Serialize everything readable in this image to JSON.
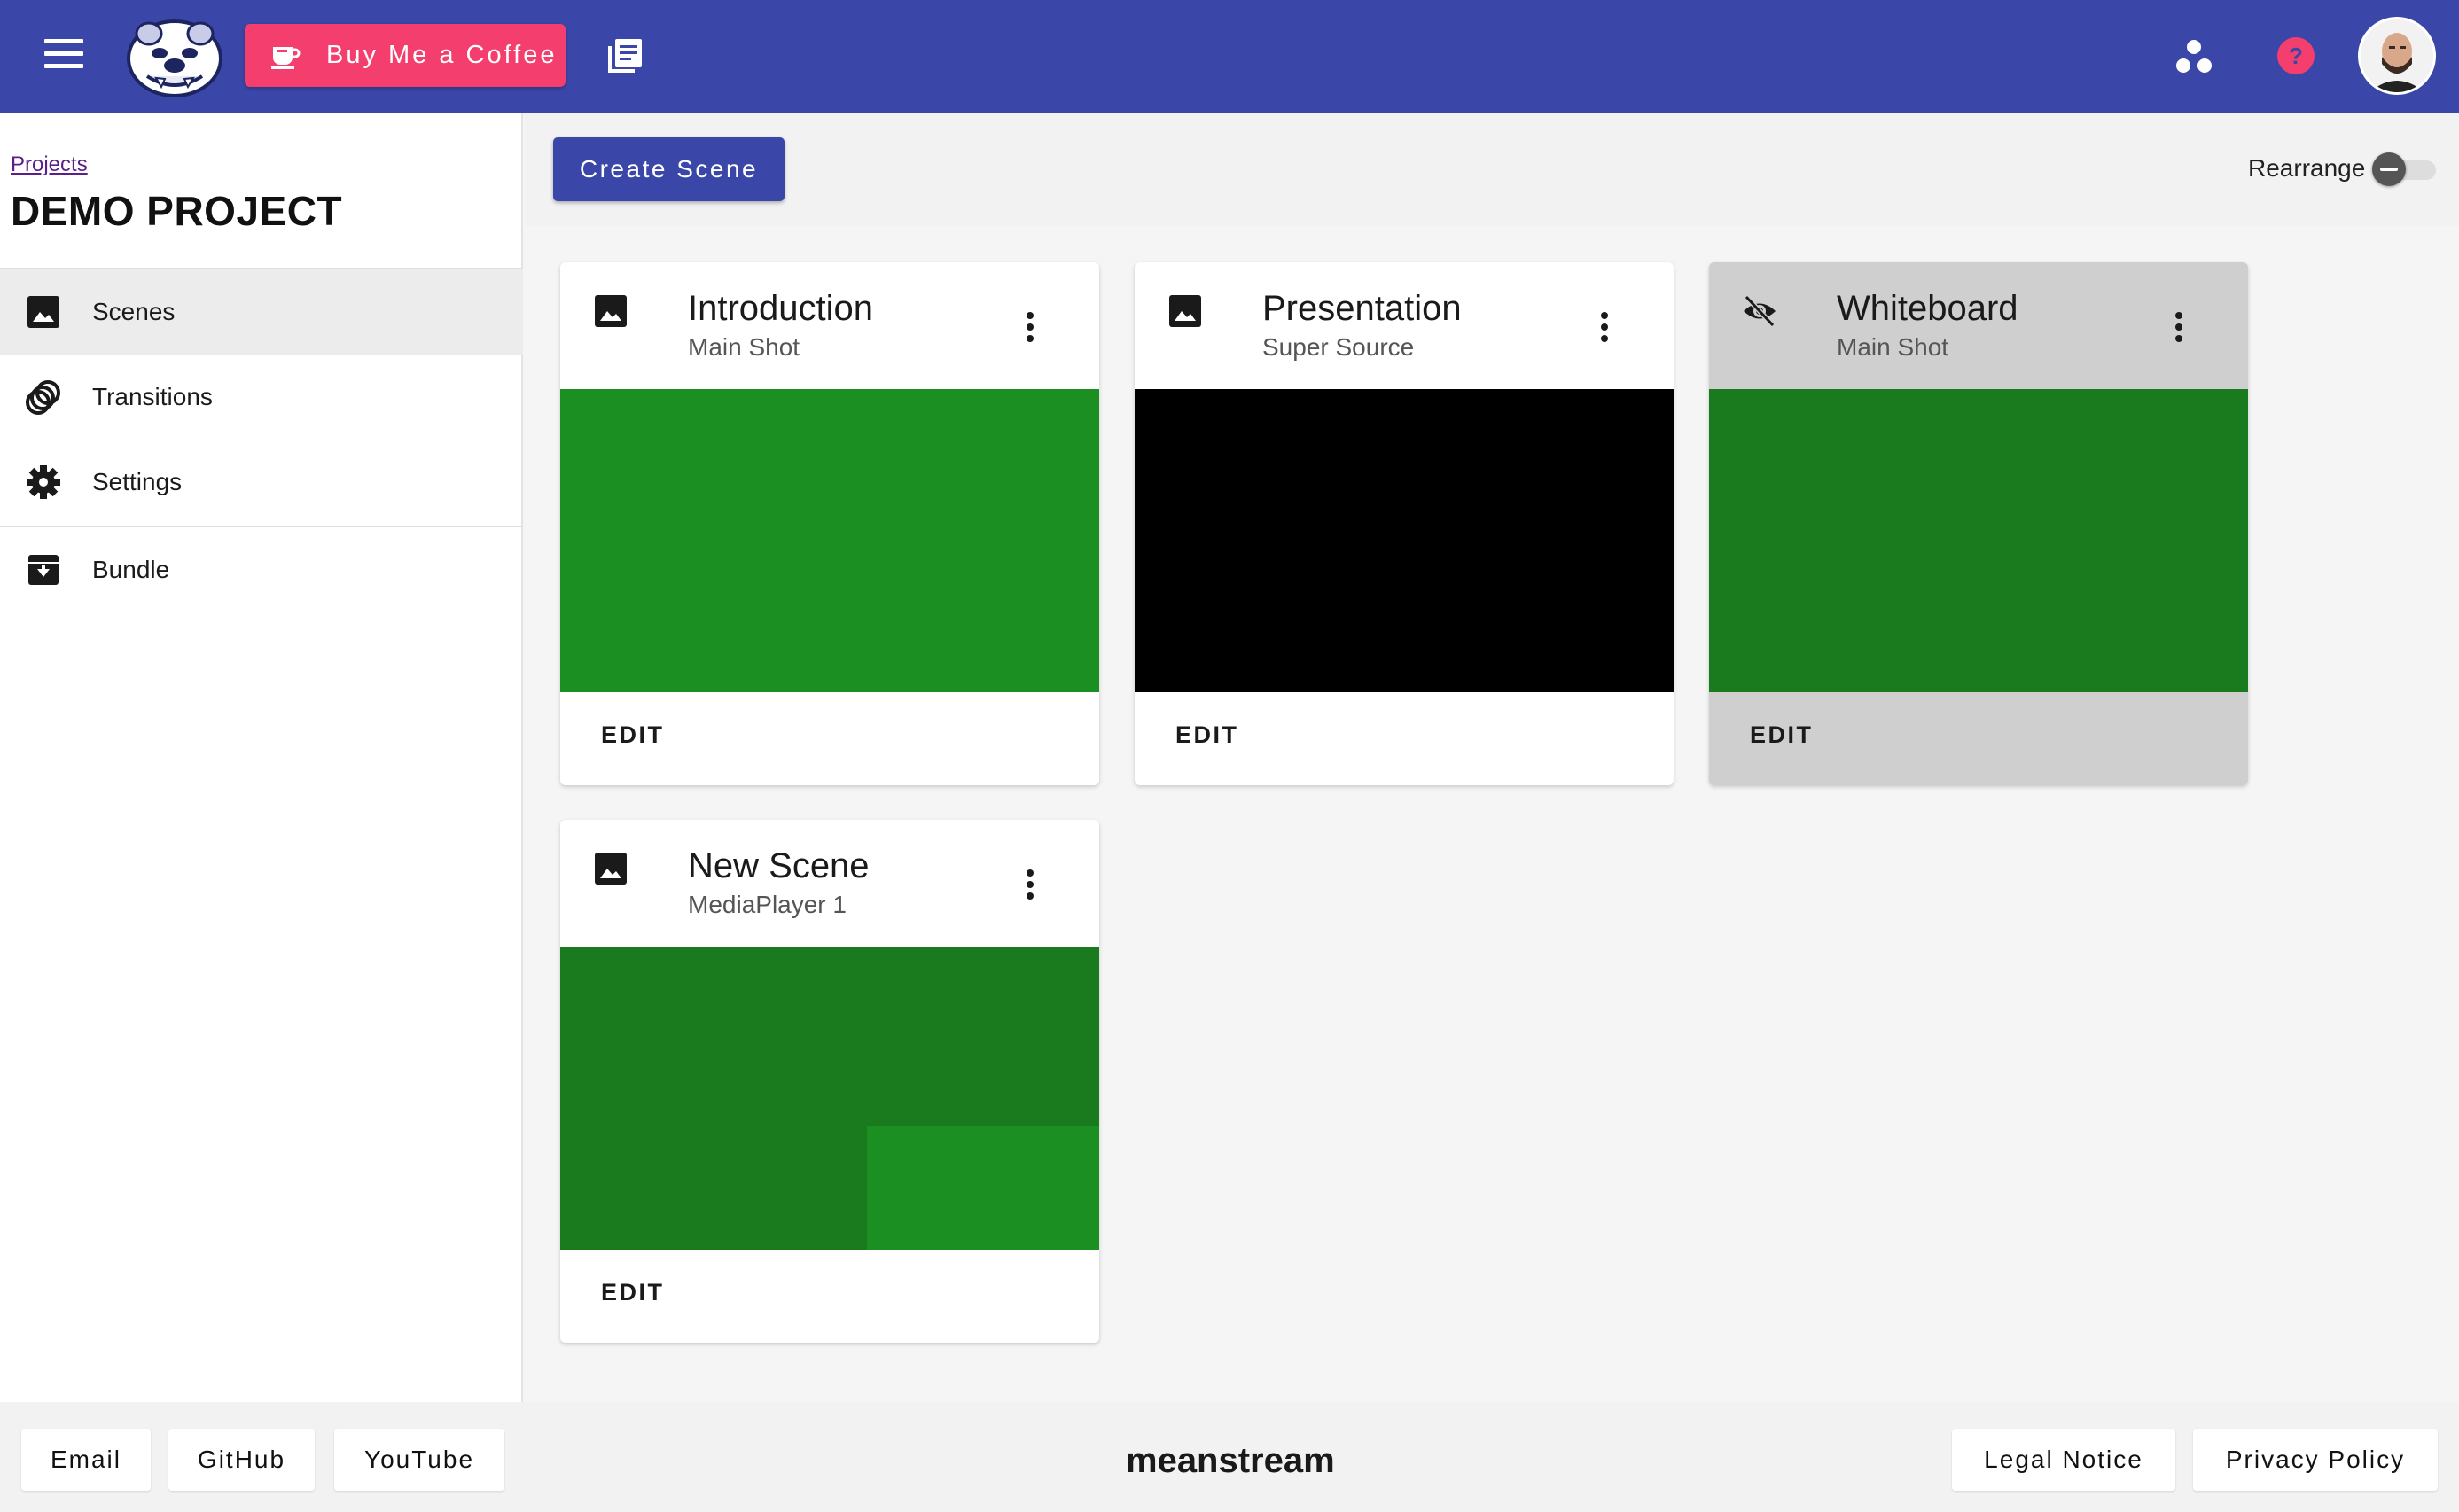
{
  "topbar": {
    "coffee_label": "Buy Me a Coffee",
    "brand_color": "#3a47a8",
    "coffee_color": "#f33e6e",
    "help_color": "#f33e6e"
  },
  "sidebar": {
    "breadcrumb": "Projects",
    "project_title": "DEMO PROJECT",
    "items": [
      {
        "label": "Scenes",
        "icon": "image-icon"
      },
      {
        "label": "Transitions",
        "icon": "transitions-icon"
      },
      {
        "label": "Settings",
        "icon": "gear-icon"
      },
      {
        "label": "Bundle",
        "icon": "archive-icon"
      }
    ]
  },
  "toolbar": {
    "create_label": "Create Scene",
    "rearrange_label": "Rearrange"
  },
  "scenes": [
    {
      "title": "Introduction",
      "subtitle": "Main Shot",
      "edit": "EDIT",
      "preview_color": "#1b8f22",
      "hidden": false
    },
    {
      "title": "Presentation",
      "subtitle": "Super Source",
      "edit": "EDIT",
      "preview_color": "#000000",
      "hidden": false
    },
    {
      "title": "Whiteboard",
      "subtitle": "Main Shot",
      "edit": "EDIT",
      "preview_color": "#1a7a1e",
      "hidden": true
    },
    {
      "title": "New Scene",
      "subtitle": "MediaPlayer 1",
      "edit": "EDIT",
      "preview_color": "#1a7a1e",
      "inset_color": "#1b8f22",
      "hidden": false
    }
  ],
  "footer": {
    "email": "Email",
    "github": "GitHub",
    "youtube": "YouTube",
    "brand": "meanstream",
    "legal": "Legal Notice",
    "privacy": "Privacy Policy"
  }
}
